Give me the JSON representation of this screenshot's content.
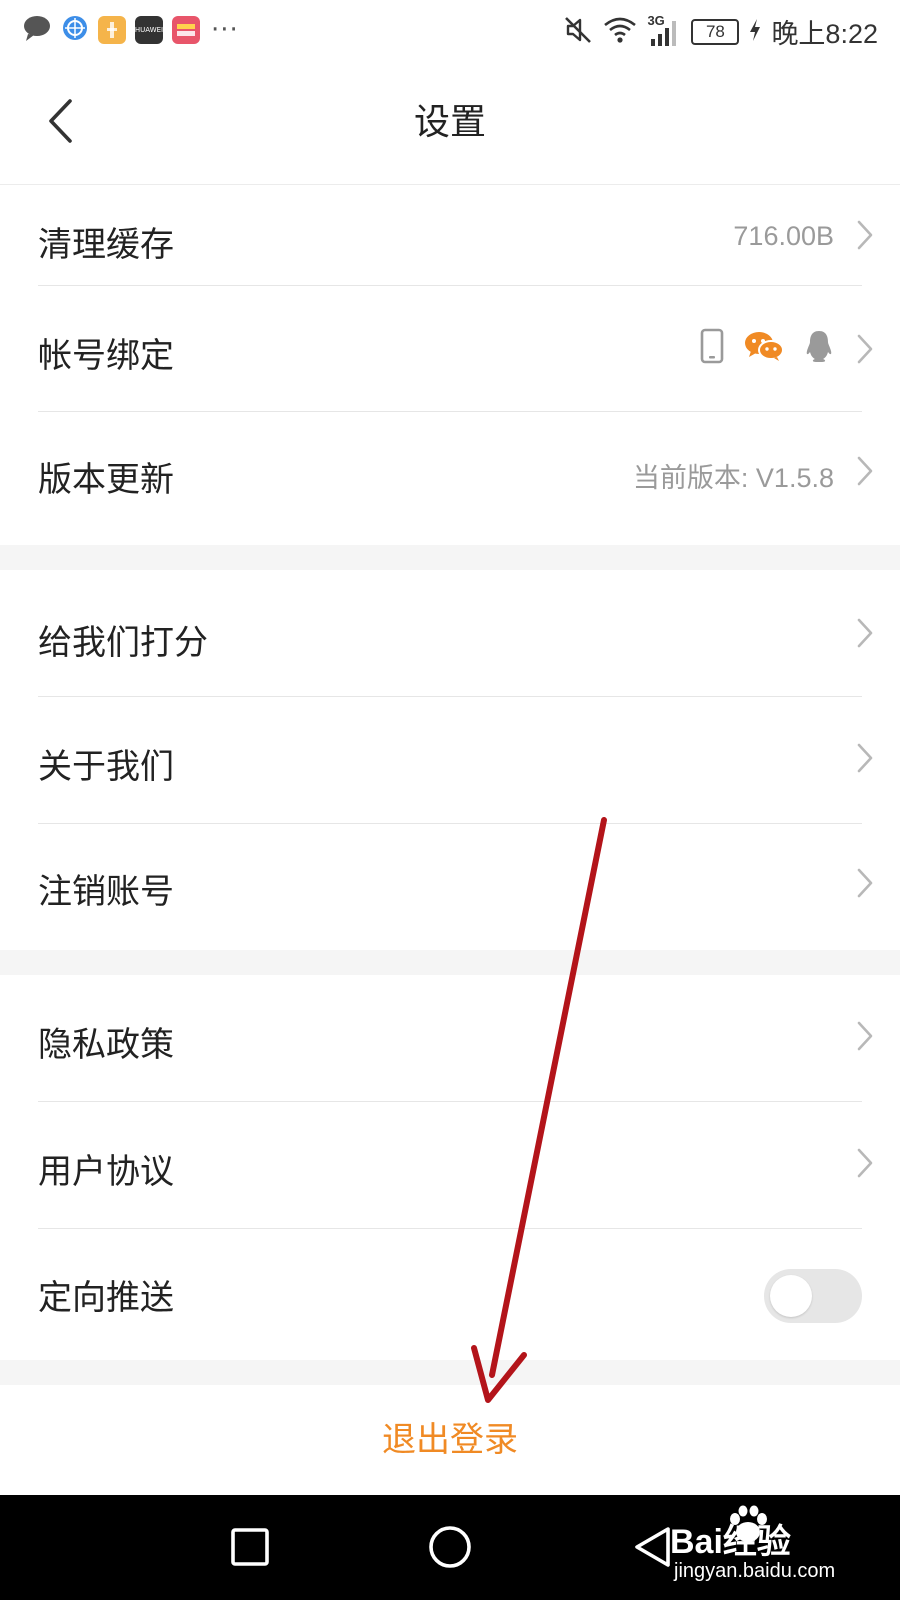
{
  "status_bar": {
    "huawei_label": "HUAWEI",
    "more": "···",
    "network": "3G",
    "battery": "78",
    "time": "晚上8:22"
  },
  "header": {
    "title": "设置",
    "back_icon": "chevron-left-icon"
  },
  "groups": [
    {
      "items": [
        {
          "label": "清理缓存",
          "value": "716.00B"
        },
        {
          "label": "帐号绑定",
          "value": "",
          "icons": [
            "phone-icon",
            "wechat-icon",
            "qq-icon"
          ]
        },
        {
          "label": "版本更新",
          "value": "当前版本: V1.5.8"
        }
      ]
    },
    {
      "items": [
        {
          "label": "给我们打分"
        },
        {
          "label": "关于我们"
        },
        {
          "label": "注销账号"
        }
      ]
    },
    {
      "items": [
        {
          "label": "隐私政策"
        },
        {
          "label": "用户协议"
        },
        {
          "label": "定向推送",
          "toggle": false
        }
      ]
    }
  ],
  "logout": {
    "label": "退出登录"
  },
  "watermark": {
    "brand": "Bai经验",
    "url": "jingyan.baidu.com"
  },
  "colors": {
    "accent": "#f08a24",
    "annotation_arrow": "#b3141a",
    "wechat_icon": "#f08a24",
    "secondary_text": "#9a9a9a"
  }
}
